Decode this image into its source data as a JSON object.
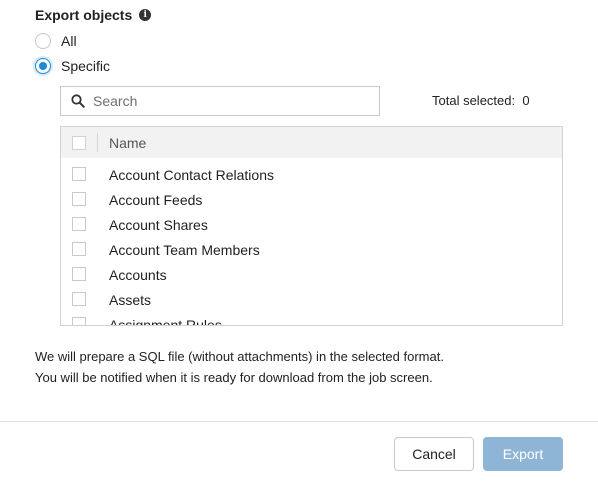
{
  "header": {
    "title": "Export objects",
    "info_icon": "info-icon"
  },
  "options": {
    "all_label": "All",
    "specific_label": "Specific",
    "selected": "Specific"
  },
  "search": {
    "placeholder": "Search",
    "value": ""
  },
  "total": {
    "label": "Total selected:",
    "count": "0"
  },
  "table": {
    "header_name": "Name",
    "rows": [
      "Account Contact Relations",
      "Account Feeds",
      "Account Shares",
      "Account Team Members",
      "Accounts",
      "Assets",
      "Assignment Rules"
    ]
  },
  "note": {
    "line1": "We will prepare a SQL file (without attachments) in the selected format.",
    "line2": "You will be notified when it is ready for download from the job screen."
  },
  "buttons": {
    "cancel": "Cancel",
    "export": "Export"
  },
  "colors": {
    "accent": "#1d8ad6",
    "export_button": "#8fb5d6"
  }
}
